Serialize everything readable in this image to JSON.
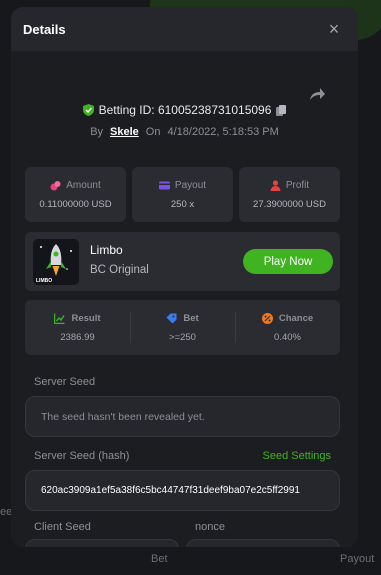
{
  "background": {
    "footer_left": "Bet",
    "footer_right": "Payout",
    "left_fragment": "ee"
  },
  "modal": {
    "title": "Details",
    "close_label": "×"
  },
  "bet": {
    "id_label": "Betting ID: 610052387310150​96",
    "by_label": "By",
    "username": "Skele",
    "on_label": "On",
    "datetime": "4/18/2022, 5:18:53 PM"
  },
  "stats": [
    {
      "label": "Amount",
      "value": "0.11000000 USD",
      "icon": "coins-icon",
      "color": "#e8417e"
    },
    {
      "label": "Payout",
      "value": "250 x",
      "icon": "card-icon",
      "color": "#7b52e6"
    },
    {
      "label": "Profit",
      "value": "27.3900000 USD",
      "icon": "user-profit-icon",
      "color": "#e8423f"
    }
  ],
  "game": {
    "name": "Limbo",
    "provider": "BC Original",
    "thumb_label": "LIMBO",
    "play_label": "Play Now"
  },
  "result_row": [
    {
      "label": "Result",
      "value": "2386.99",
      "icon": "chart-icon",
      "color": "#3fb320"
    },
    {
      "label": "Bet",
      "value": ">=250",
      "icon": "tag-icon",
      "color": "#3b7bf0"
    },
    {
      "label": "Chance",
      "value": "0.40%",
      "icon": "percent-icon",
      "color": "#f07a1d"
    }
  ],
  "server_seed": {
    "label": "Server Seed",
    "value": "The seed hasn't been revealed yet."
  },
  "server_seed_hash": {
    "label": "Server Seed (hash)",
    "settings_label": "Seed Settings",
    "value": "620ac3909a1ef5a38f6c5bc44747f31deef9ba07e2c5ff2991"
  },
  "client_seed": {
    "label": "Client Seed"
  },
  "nonce": {
    "label": "nonce"
  },
  "colors": {
    "accent_green": "#3fb320",
    "panel": "#1c1d21",
    "card": "#2a2c31"
  }
}
